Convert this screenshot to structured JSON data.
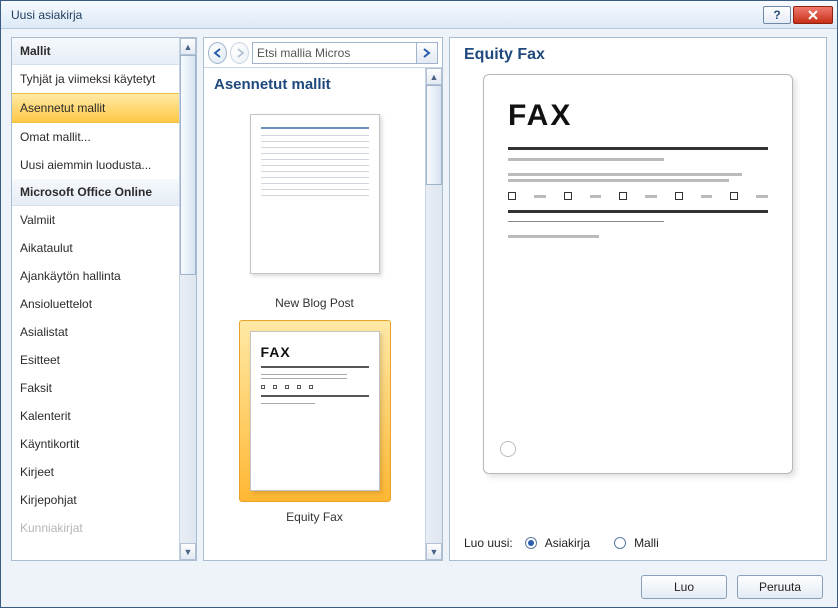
{
  "window": {
    "title": "Uusi asiakirja"
  },
  "sidebar": {
    "header1": "Mallit",
    "header2": "Microsoft Office Online",
    "items_top": [
      "Tyhjät ja viimeksi käytetyt",
      "Asennetut mallit",
      "Omat mallit...",
      "Uusi aiemmin luodusta..."
    ],
    "items_online": [
      "Valmiit",
      "Aikataulut",
      "Ajankäytön hallinta",
      "Ansioluettelot",
      "Asialistat",
      "Esitteet",
      "Faksit",
      "Kalenterit",
      "Käyntikortit",
      "Kirjeet",
      "Kirjepohjat",
      "Kunniakirjat"
    ],
    "selected": "Asennetut mallit"
  },
  "search": {
    "placeholder": "Etsi mallia Micros"
  },
  "gallery": {
    "section_title": "Asennetut mallit",
    "items": [
      {
        "label": "New Blog Post",
        "kind": "blog",
        "selected": false
      },
      {
        "label": "Equity Fax",
        "kind": "fax",
        "selected": true
      }
    ]
  },
  "preview": {
    "title": "Equity Fax",
    "doc_heading": "FAX"
  },
  "create": {
    "label": "Luo uusi:",
    "option_doc": "Asiakirja",
    "option_tpl": "Malli",
    "selected": "Asiakirja"
  },
  "buttons": {
    "create": "Luo",
    "cancel": "Peruuta"
  }
}
